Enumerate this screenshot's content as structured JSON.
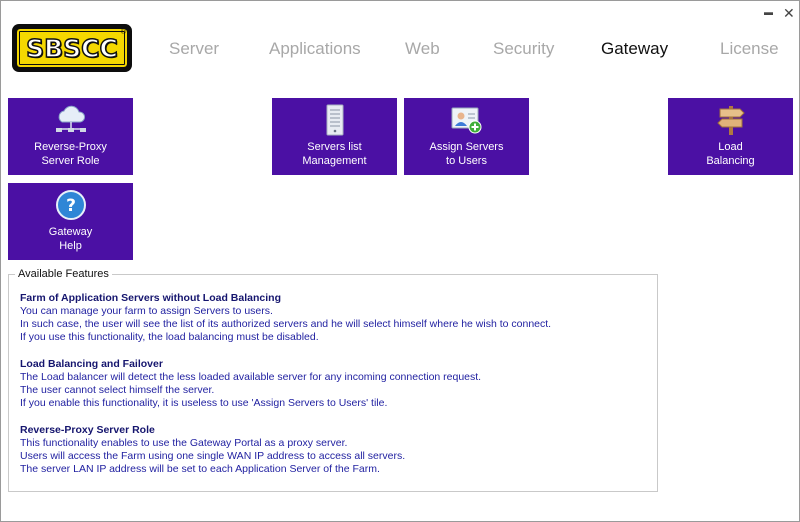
{
  "logo": {
    "text": "SBSCC",
    "reg": "®"
  },
  "window": {
    "minimize": "▬",
    "close": "✕"
  },
  "nav": {
    "server": "Server",
    "applications": "Applications",
    "web": "Web",
    "security": "Security",
    "gateway": "Gateway",
    "license": "License"
  },
  "tiles": {
    "reverse_proxy": {
      "line1": "Reverse-Proxy",
      "line2": "Server Role"
    },
    "servers_list": {
      "line1": "Servers list",
      "line2": "Management"
    },
    "assign_servers": {
      "line1": "Assign Servers",
      "line2": "to Users"
    },
    "load_balancing": {
      "line1": "Load",
      "line2": "Balancing"
    },
    "gateway_help": {
      "line1": "Gateway",
      "line2": "Help"
    }
  },
  "features": {
    "legend": "Available Features",
    "items": [
      {
        "title": "Farm of Application Servers without Load Balancing",
        "lines": [
          "You can manage your farm to assign Servers to users.",
          "In such case, the user will see the list of its authorized servers and he will select himself where he wish to connect.",
          "If you use this functionality, the load balancing must be disabled."
        ]
      },
      {
        "title": "Load Balancing and Failover",
        "lines": [
          "The Load balancer will detect the less loaded available server for any incoming connection request.",
          "The user cannot select himself the server.",
          "If you enable this functionality, it is useless to use 'Assign  Servers to Users' tile."
        ]
      },
      {
        "title": "Reverse-Proxy Server Role",
        "lines": [
          "This functionality enables to use the Gateway Portal as a proxy server.",
          "Users will access the Farm using one single WAN IP address to access all servers.",
          "The server LAN IP address will be set to each Application Server of the Farm."
        ]
      }
    ]
  },
  "colors": {
    "tile": "#4b10a4",
    "feature_title": "#15156e",
    "feature_text": "#1f1fa0",
    "logo_yellow": "#f5d800"
  }
}
